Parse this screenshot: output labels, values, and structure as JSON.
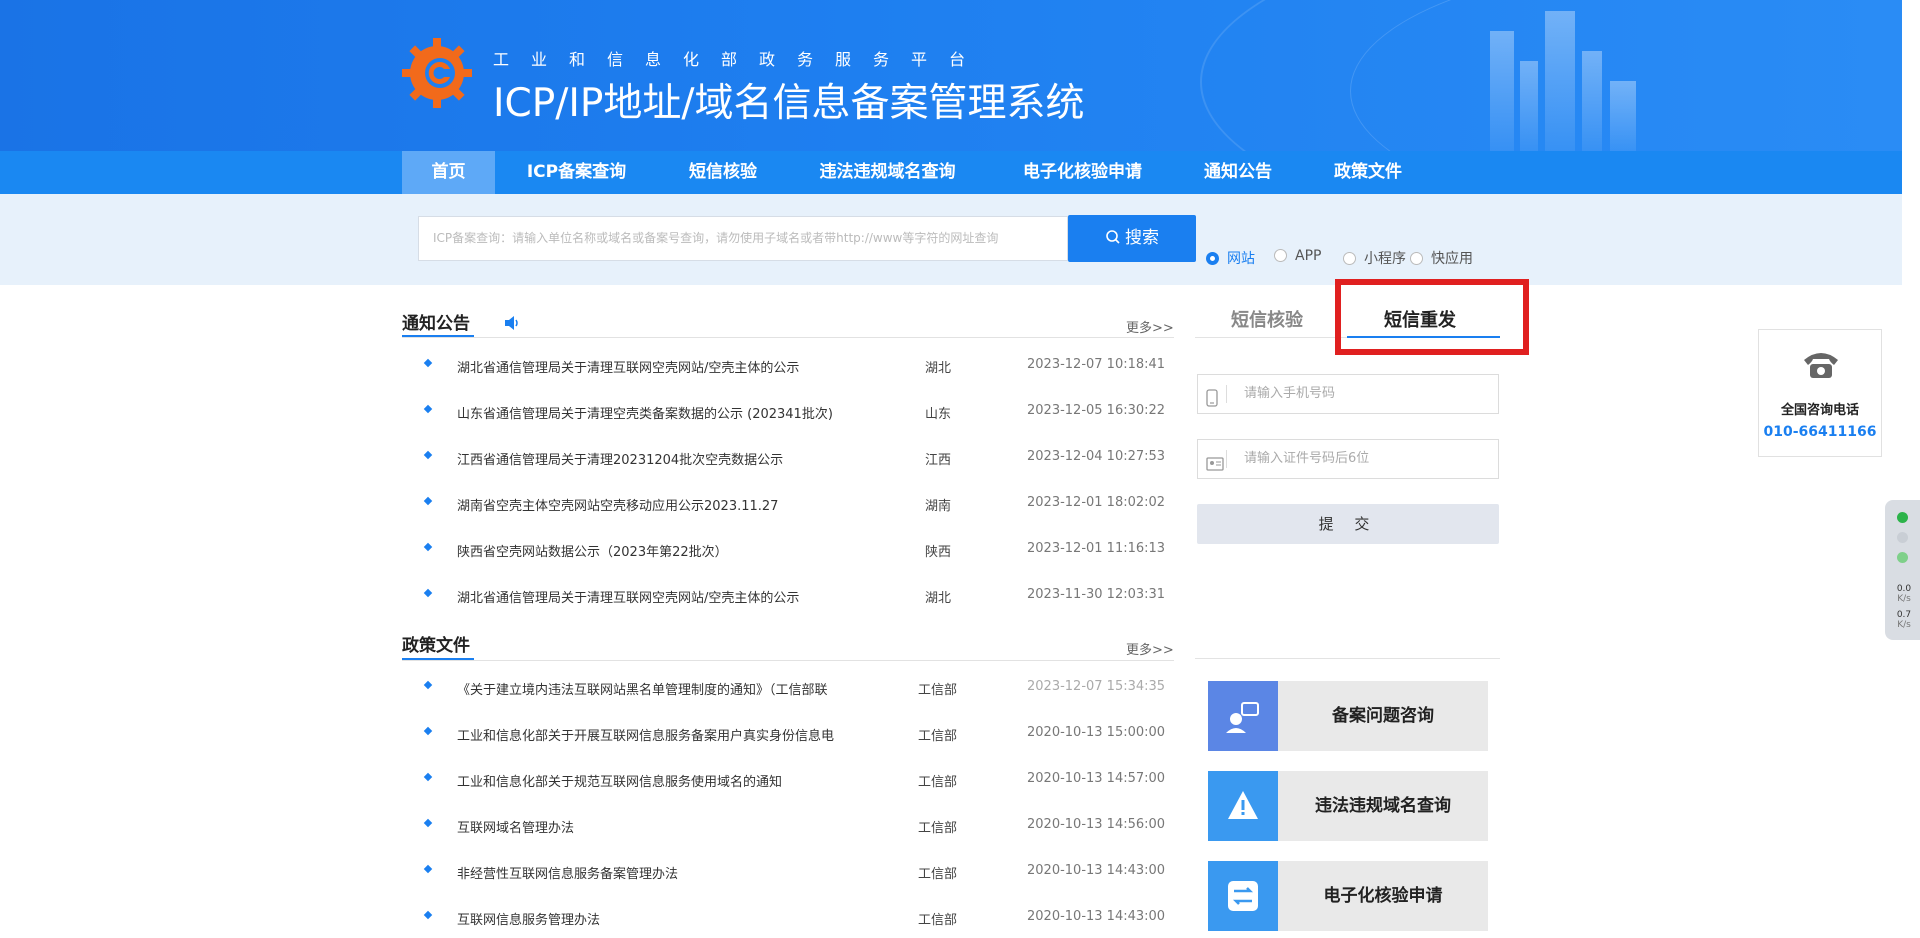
{
  "header": {
    "subtitle": "工业和信息化部政务服务平台",
    "title": "ICP/IP地址/域名信息备案管理系统"
  },
  "nav": {
    "items": [
      {
        "label": "首页",
        "active": true
      },
      {
        "label": "ICP备案查询"
      },
      {
        "label": "短信核验"
      },
      {
        "label": "违法违规域名查询"
      },
      {
        "label": "电子化核验申请"
      },
      {
        "label": "通知公告"
      },
      {
        "label": "政策文件"
      }
    ]
  },
  "search": {
    "placeholder": "ICP备案查询：请输入单位名称或域名或备案号查询，请勿使用子域名或者带http://www等字符的网址查询",
    "button": "搜索",
    "options": [
      {
        "label": "网站",
        "selected": true
      },
      {
        "label": "APP"
      },
      {
        "label": "小程序"
      },
      {
        "label": "快应用"
      }
    ]
  },
  "notices": {
    "title": "通知公告",
    "more": "更多>>",
    "items": [
      {
        "title": "湖北省通信管理局关于清理互联网空壳网站/空壳主体的公示",
        "region": "湖北",
        "date": "2023-12-07 10:18:41"
      },
      {
        "title": "山东省通信管理局关于清理空壳类备案数据的公示 (202341批次)",
        "region": "山东",
        "date": "2023-12-05 16:30:22"
      },
      {
        "title": "江西省通信管理局关于清理20231204批次空壳数据公示",
        "region": "江西",
        "date": "2023-12-04 10:27:53"
      },
      {
        "title": "湖南省空壳主体空壳网站空壳移动应用公示2023.11.27",
        "region": "湖南",
        "date": "2023-12-01 18:02:02"
      },
      {
        "title": "陕西省空壳网站数据公示（2023年第22批次）",
        "region": "陕西",
        "date": "2023-12-01 11:16:13"
      },
      {
        "title": "湖北省通信管理局关于清理互联网空壳网站/空壳主体的公示",
        "region": "湖北",
        "date": "2023-11-30 12:03:31"
      }
    ]
  },
  "policies": {
    "title": "政策文件",
    "more": "更多>>",
    "items": [
      {
        "title": "《关于建立境内违法互联网站黑名单管理制度的通知》（工信部联",
        "region": "工信部",
        "date": "2023-12-07 15:34:35"
      },
      {
        "title": "工业和信息化部关于开展互联网信息服务备案用户真实身份信息电",
        "region": "工信部",
        "date": "2020-10-13 15:00:00"
      },
      {
        "title": "工业和信息化部关于规范互联网信息服务使用域名的通知",
        "region": "工信部",
        "date": "2020-10-13 14:57:00"
      },
      {
        "title": "互联网域名管理办法",
        "region": "工信部",
        "date": "2020-10-13 14:56:00"
      },
      {
        "title": "非经营性互联网信息服务备案管理办法",
        "region": "工信部",
        "date": "2020-10-13 14:43:00"
      },
      {
        "title": "互联网信息服务管理办法",
        "region": "工信部",
        "date": "2020-10-13 14:43:00"
      }
    ]
  },
  "sms": {
    "tab_verify": "短信核验",
    "tab_resend": "短信重发",
    "active_tab": "短信重发",
    "phone_placeholder": "请输入手机号码",
    "id_placeholder": "请输入证件号码后6位",
    "submit": "提 交"
  },
  "quick_links": [
    {
      "label": "备案问题咨询",
      "icon": "consult-icon",
      "color": "#5b86e5"
    },
    {
      "label": "违法违规域名查询",
      "icon": "warning-icon",
      "color": "#3a99f0"
    },
    {
      "label": "电子化核验申请",
      "icon": "exchange-icon",
      "color": "#3a99f0"
    }
  ],
  "hotline": {
    "label": "全国咨询电话",
    "number": "010-66411166"
  },
  "net_widget": {
    "up": "0.0",
    "up_unit": "K/s",
    "down": "0.7",
    "down_unit": "K/s"
  },
  "colors": {
    "accent": "#1a7ff0",
    "highlight_box": "#e02020"
  }
}
